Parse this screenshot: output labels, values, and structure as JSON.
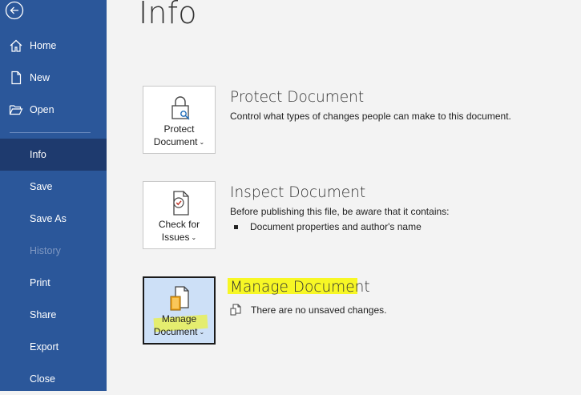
{
  "sidebar": {
    "items": [
      {
        "label": "Home",
        "icon": "home-icon"
      },
      {
        "label": "New",
        "icon": "new-document-icon"
      },
      {
        "label": "Open",
        "icon": "folder-open-icon"
      },
      {
        "label": "Info"
      },
      {
        "label": "Save"
      },
      {
        "label": "Save As"
      },
      {
        "label": "History"
      },
      {
        "label": "Print"
      },
      {
        "label": "Share"
      },
      {
        "label": "Export"
      },
      {
        "label": "Close"
      }
    ],
    "selected": "Info",
    "disabled": [
      "History"
    ],
    "color": "#2b579a",
    "selected_color": "#1e3a6e"
  },
  "page": {
    "title": "Info"
  },
  "sections": {
    "protect": {
      "button_line1": "Protect",
      "button_line2": "Document",
      "title": "Protect Document",
      "description": "Control what types of changes people can make to this document."
    },
    "inspect": {
      "button_line1": "Check for",
      "button_line2": "Issues",
      "title": "Inspect Document",
      "description": "Before publishing this file, be aware that it contains:",
      "bullets": [
        "Document properties and author's name"
      ]
    },
    "manage": {
      "button_line1": "Manage",
      "button_line2": "Document",
      "title": "Manage Document",
      "status": "There are no unsaved changes."
    }
  },
  "highlight_color": "#f7f700"
}
